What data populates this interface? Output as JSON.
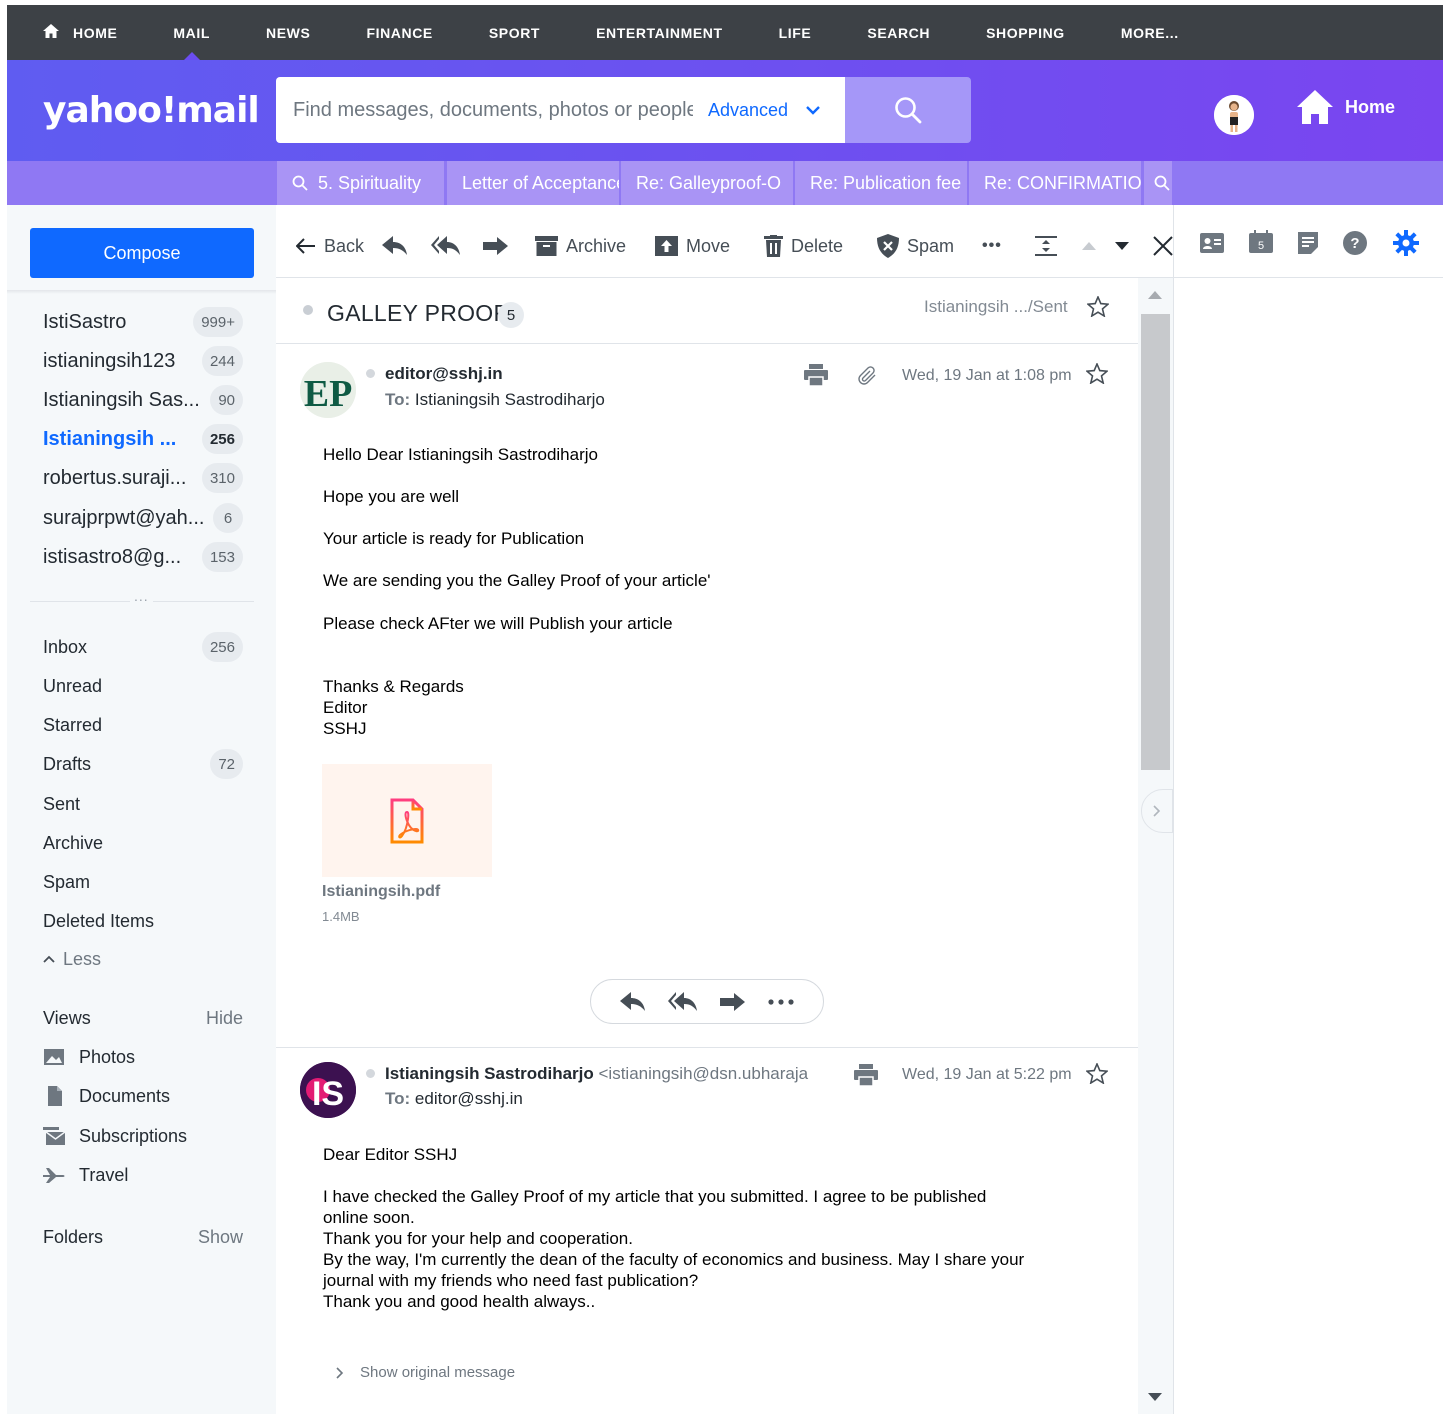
{
  "topnav": {
    "items": [
      "HOME",
      "MAIL",
      "NEWS",
      "FINANCE",
      "SPORT",
      "ENTERTAINMENT",
      "LIFE",
      "SEARCH",
      "SHOPPING",
      "MORE..."
    ],
    "active": "MAIL"
  },
  "header": {
    "logo": "yahoo!mail",
    "search_placeholder": "Find messages, documents, photos or people",
    "advanced_label": "Advanced",
    "home_label": "Home",
    "accent": "#6c51f0"
  },
  "tabs": [
    "5. Spirituality",
    "Letter of Acceptance",
    "Re: Galleyproof-O",
    "Re: Publication fee",
    "Re: CONFIRMATION"
  ],
  "sidebar": {
    "compose_label": "Compose",
    "accounts": [
      {
        "name": "IstiSastro",
        "count": "999+"
      },
      {
        "name": "istianingsih123",
        "count": "244"
      },
      {
        "name": "Istianingsih Sas...",
        "count": "90"
      },
      {
        "name": "Istianingsih ...",
        "count": "256"
      },
      {
        "name": "robertus.suraji...",
        "count": "310"
      },
      {
        "name": "surajprpwt@yah...",
        "count": "6"
      },
      {
        "name": "istisastro8@g...",
        "count": "153"
      }
    ],
    "more_label": "...",
    "folders": [
      {
        "name": "Inbox",
        "count": "256"
      },
      {
        "name": "Unread",
        "count": ""
      },
      {
        "name": "Starred",
        "count": ""
      },
      {
        "name": "Drafts",
        "count": "72"
      },
      {
        "name": "Sent",
        "count": ""
      },
      {
        "name": "Archive",
        "count": ""
      },
      {
        "name": "Spam",
        "count": ""
      },
      {
        "name": "Deleted Items",
        "count": ""
      }
    ],
    "less_label": "Less",
    "views_label": "Views",
    "hide_label": "Hide",
    "views": [
      "Photos",
      "Documents",
      "Subscriptions",
      "Travel"
    ],
    "folders_label": "Folders",
    "show_label": "Show"
  },
  "toolbar": {
    "back": "Back",
    "archive": "Archive",
    "move": "Move",
    "delete": "Delete",
    "spam": "Spam",
    "more": "•••"
  },
  "thread": {
    "subject": "GALLEY PROOF",
    "count": "5",
    "folder": "Istianingsih .../Sent"
  },
  "messages": [
    {
      "avatar": "EP",
      "sender": "editor@sshj.in",
      "to_label": "To:",
      "to": "Istianingsih Sastrodiharjo",
      "date": "Wed, 19 Jan at 1:08 pm",
      "body": [
        "Hello Dear Istianingsih Sastrodiharjo",
        "Hope you are well",
        "Your article is ready for Publication",
        "We are sending you the Galley Proof of your article'",
        "Please check AFter we will Publish your article",
        "Thanks & Regards",
        "Editor",
        "SSHJ"
      ],
      "attachment": {
        "name": "Istianingsih.pdf",
        "size": "1.4MB"
      }
    },
    {
      "avatar": "IS",
      "sender": "Istianingsih Sastrodiharjo",
      "sender_email": "<istianingsih@dsn.ubharaja",
      "to_label": "To:",
      "to": "editor@sshj.in",
      "date": "Wed, 19 Jan at 5:22 pm",
      "body": [
        "Dear Editor SSHJ",
        "I have checked the Galley Proof of my article that you submitted. I agree to be published",
        "online soon.",
        "Thank you for your help and cooperation.",
        "By the way, I'm currently the dean of the faculty of economics and business. May I share your",
        "journal with my friends who need fast publication?",
        "Thank you and good health always.."
      ],
      "show_original": "Show original message"
    }
  ],
  "rightrail": {
    "calendar_day": "5"
  }
}
